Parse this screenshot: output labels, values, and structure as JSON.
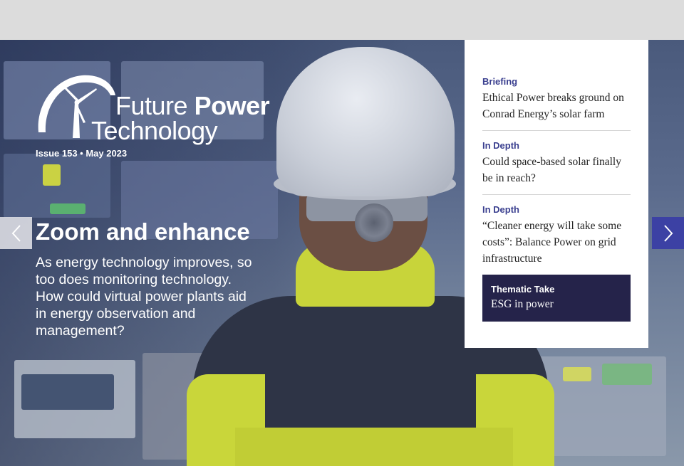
{
  "brand": {
    "name_line1_regular": "Future",
    "name_line1_bold": "Power",
    "name_line2": "Technology",
    "issue": "Issue 153 • May 2023"
  },
  "hero": {
    "title": "Zoom and enhance",
    "description": "As energy technology improves, so too does monitoring technology. How could virtual power plants aid in energy observation and management?"
  },
  "nav": {
    "prev_icon": "chevron-left-icon",
    "next_icon": "chevron-right-icon"
  },
  "panel": {
    "items": [
      {
        "category": "Briefing",
        "headline": "Ethical Power breaks ground on Conrad Energy’s solar farm"
      },
      {
        "category": "In Depth",
        "headline": "Could space-based solar finally be in reach?"
      },
      {
        "category": "In Depth",
        "headline": "“Cleaner energy will take some costs”: Balance Power on grid infrastructure"
      }
    ],
    "thematic": {
      "category": "Thematic Take",
      "title": "ESG in power"
    }
  },
  "colors": {
    "accent": "#3c41a4",
    "category_text": "#3a3f8f",
    "thematic_bg": "#25234a"
  }
}
